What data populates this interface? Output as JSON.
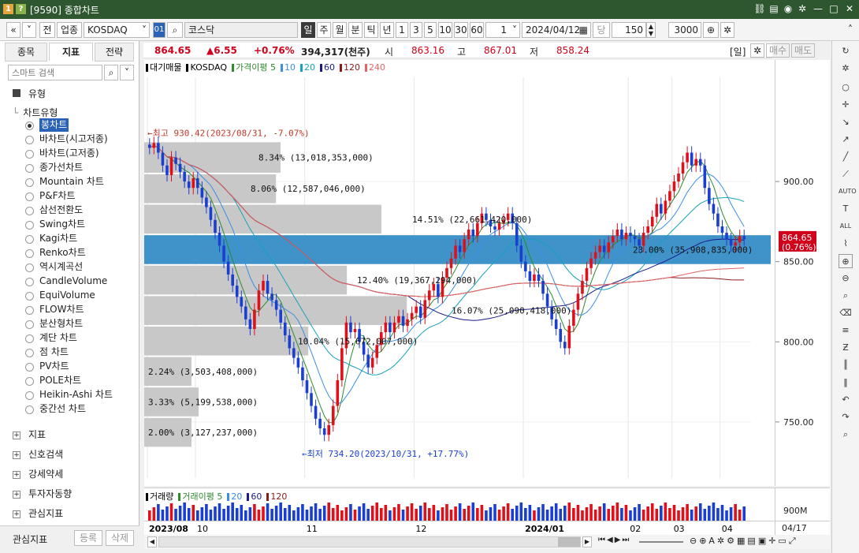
{
  "window": {
    "title": "[9590] 종합차트",
    "badge1": "1",
    "badge2": "?"
  },
  "toolbar": {
    "prev": "«",
    "menu": "≡",
    "jeon": "전",
    "upjong": "업종",
    "code": "KOSDAQ",
    "code_num": "01",
    "search_name": "코스닥",
    "periods": [
      "일",
      "주",
      "월",
      "분",
      "틱",
      "년"
    ],
    "numbers": [
      "1",
      "3",
      "5",
      "10",
      "30",
      "60"
    ],
    "count": "1",
    "date": "2024/04/12",
    "unit": "당",
    "show_count": "150",
    "slash": "/",
    "total": "3000"
  },
  "left_panel": {
    "tabs": [
      "종목",
      "지표",
      "전략"
    ],
    "search_placeholder": "스마트 검색",
    "section_title": "유형",
    "subsection": "차트유형",
    "chart_types": [
      "봉차트",
      "바차트(시고저종)",
      "바차트(고저종)",
      "종가선차트",
      "Mountain 차트",
      "P&F차트",
      "삼선전환도",
      "Swing차트",
      "Kagi차트",
      "Renko차트",
      "역시계곡선",
      "CandleVolume",
      "EquiVolume",
      "FLOW차트",
      "분산형차트",
      "계단 차트",
      "점 차트",
      "PV차트",
      "POLE차트",
      "Heikin-Ashi 차트",
      "중간선 차트"
    ],
    "selected_index": 0,
    "sections": [
      "지표",
      "신호검색",
      "강세약세",
      "투자자동향",
      "관심지표"
    ],
    "footer_label": "관심지표",
    "register": "등록",
    "delete": "삭제"
  },
  "price_bar": {
    "price": "864.65",
    "change": "▲6.55",
    "change_pct": "+0.76%",
    "volume": "394,317(천주)",
    "open_label": "시",
    "open": "863.16",
    "high_label": "고",
    "high": "867.01",
    "low_label": "저",
    "low": "858.24",
    "period_badge": "[일]",
    "buy": "매수",
    "sell": "매도"
  },
  "legend": {
    "items": [
      {
        "text": "대기매물",
        "color": "#000000"
      },
      {
        "text": "KOSDAQ",
        "color": "#000000"
      },
      {
        "text": "가격이평 5",
        "color": "#2e8b2e"
      },
      {
        "text": "10",
        "color": "#3a8ee6"
      },
      {
        "text": "20",
        "color": "#17a2b8"
      },
      {
        "text": "60",
        "color": "#1a1a8c"
      },
      {
        "text": "120",
        "color": "#8b1a1a"
      },
      {
        "text": "240",
        "color": "#e06666"
      }
    ]
  },
  "annotations": {
    "high": "←최고 930.42(2023/08/31, -7.07%)",
    "low": "←최저 734.20(2023/10/31, +17.77%)"
  },
  "chart_data": {
    "type": "candlestick",
    "title": "KOSDAQ",
    "ylim": [
      715,
      965
    ],
    "yticks": [
      750,
      800,
      850,
      900
    ],
    "ytick_labels": [
      "750.00",
      "800.00",
      "850.00",
      "900.00"
    ],
    "xticks": [
      "2023/08",
      "10",
      "11",
      "12",
      "2024/01",
      "02",
      "03",
      "04"
    ],
    "current_price_label": "864.65",
    "current_change_label": "(0.76%)",
    "volume_profile": [
      {
        "label": "8.34% (13,018,353,000)",
        "pct": 8.34,
        "lo": 905,
        "hi": 925
      },
      {
        "label": "8.06% (12,587,046,000)",
        "pct": 8.06,
        "lo": 886,
        "hi": 905
      },
      {
        "label": "14.51% (22,661,420,000)",
        "pct": 14.51,
        "lo": 867,
        "hi": 886
      },
      {
        "label": "23.00% (35,908,835,000)",
        "pct": 23.0,
        "lo": 848,
        "hi": 867
      },
      {
        "label": "12.40% (19,367,294,000)",
        "pct": 12.4,
        "lo": 829,
        "hi": 848
      },
      {
        "label": "16.07% (25,090,418,000)",
        "pct": 16.07,
        "lo": 810,
        "hi": 829
      },
      {
        "label": "10.04% (15,672,007,000)",
        "pct": 10.04,
        "lo": 791,
        "hi": 810
      },
      {
        "label": "2.24% (3,503,408,000)",
        "pct": 2.24,
        "lo": 772,
        "hi": 791
      },
      {
        "label": "3.33% (5,199,538,000)",
        "pct": 3.33,
        "lo": 753,
        "hi": 772
      },
      {
        "label": "2.00% (3,127,237,000)",
        "pct": 2.0,
        "lo": 734,
        "hi": 753
      }
    ],
    "highlight_index": 3,
    "close_series": [
      921,
      924,
      918,
      910,
      904,
      915,
      911,
      906,
      900,
      896,
      902,
      896,
      890,
      884,
      876,
      868,
      860,
      850,
      842,
      835,
      828,
      822,
      814,
      808,
      820,
      832,
      838,
      830,
      826,
      820,
      812,
      804,
      796,
      790,
      784,
      776,
      768,
      760,
      752,
      746,
      742,
      748,
      760,
      776,
      796,
      812,
      806,
      808,
      800,
      792,
      784,
      790,
      798,
      806,
      812,
      806,
      812,
      816,
      810,
      814,
      818,
      822,
      815,
      826,
      832,
      836,
      828,
      840,
      846,
      852,
      860,
      856,
      864,
      870,
      866,
      874,
      880,
      876,
      872,
      870,
      874,
      876,
      880,
      874,
      860,
      850,
      844,
      838,
      842,
      838,
      830,
      822,
      814,
      808,
      800,
      796,
      810,
      820,
      830,
      838,
      846,
      852,
      856,
      860,
      856,
      862,
      866,
      870,
      864,
      868,
      866,
      864,
      860,
      868,
      872,
      878,
      886,
      880,
      888,
      894,
      900,
      905,
      912,
      918,
      910,
      914,
      910,
      896,
      886,
      880,
      872,
      868,
      864,
      860,
      862,
      866,
      864
    ],
    "volume_label": "900M",
    "date_label": "04/17"
  },
  "volume_legend": [
    {
      "text": "거래량",
      "color": "#000000"
    },
    {
      "text": "거래이평 5",
      "color": "#2e8b2e"
    },
    {
      "text": "20",
      "color": "#3a8ee6"
    },
    {
      "text": "60",
      "color": "#1a1a8c"
    },
    {
      "text": "120",
      "color": "#8b1a1a"
    }
  ]
}
